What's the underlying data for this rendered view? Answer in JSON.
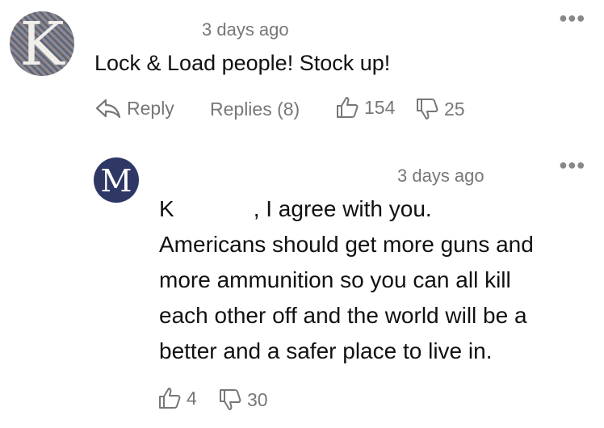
{
  "comment": {
    "avatar_letter": "K",
    "time": "3 days ago",
    "text": "Lock & Load people! Stock up!",
    "reply_label": "Reply",
    "replies_label": "Replies (8)",
    "likes": "154",
    "dislikes": "25"
  },
  "reply": {
    "avatar_letter": "M",
    "time": "3 days ago",
    "mention": "K",
    "lines": [
      ", I agree with you.",
      "Americans should get more guns and",
      "more ammunition so you can all kill",
      "each other off and the world will be a",
      "better and a safer place to live in."
    ],
    "likes": "4",
    "dislikes": "30"
  },
  "icons": {
    "more": "more-options-icon",
    "reply": "reply-arrow-icon",
    "like": "thumbs-up-icon",
    "dislike": "thumbs-down-icon"
  }
}
